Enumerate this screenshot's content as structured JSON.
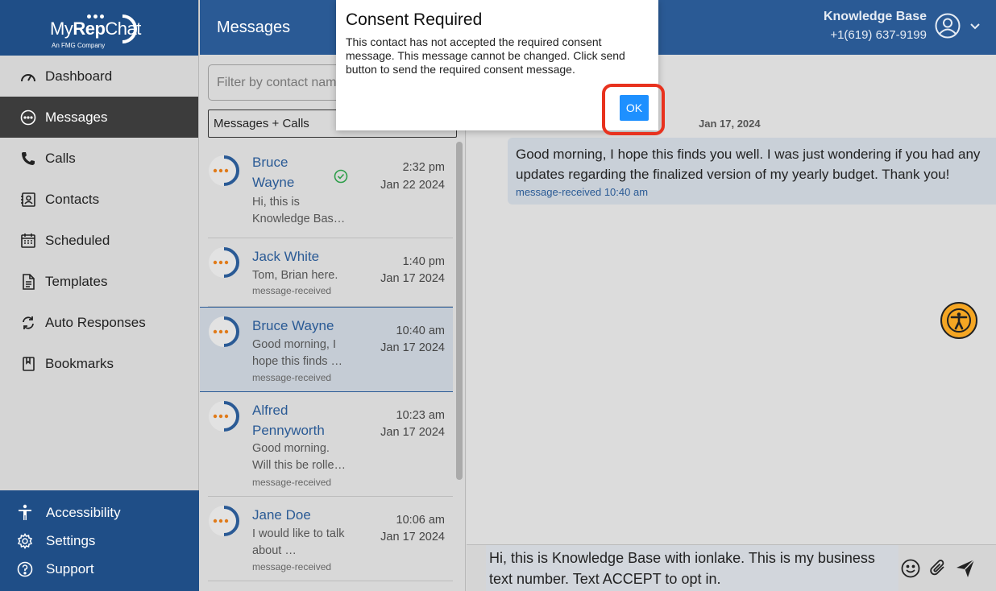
{
  "brand": {
    "logo_my": "My",
    "logo_rep": "Rep",
    "logo_chat": "Chat",
    "logo_sub": "An FMG Company"
  },
  "sidebar": {
    "items": [
      {
        "label": "Dashboard",
        "icon": "gauge-icon"
      },
      {
        "label": "Messages",
        "icon": "chat-bubble-icon",
        "active": true
      },
      {
        "label": "Calls",
        "icon": "phone-icon"
      },
      {
        "label": "Contacts",
        "icon": "contact-card-icon"
      },
      {
        "label": "Scheduled",
        "icon": "calendar-icon"
      },
      {
        "label": "Templates",
        "icon": "document-icon"
      },
      {
        "label": "Auto Responses",
        "icon": "refresh-icon"
      },
      {
        "label": "Bookmarks",
        "icon": "bookmark-icon"
      }
    ],
    "bottom": [
      {
        "label": "Accessibility",
        "icon": "accessibility-icon"
      },
      {
        "label": "Settings",
        "icon": "gear-icon"
      },
      {
        "label": "Support",
        "icon": "help-icon"
      }
    ]
  },
  "header": {
    "title": "Messages",
    "account_name": "Knowledge Base",
    "account_phone": "+1(619) 637-9199"
  },
  "list": {
    "filter_placeholder": "Filter by contact name",
    "type_select": "Messages + Calls",
    "conversations": [
      {
        "name": "Bruce Wayne",
        "preview": "Hi, this is Knowledge Bas…",
        "status": "",
        "time": "2:32 pm",
        "date": "Jan 22 2024",
        "check": true
      },
      {
        "name": "Jack White",
        "preview": "Tom, Brian here.",
        "status": "message-received",
        "time": "1:40 pm",
        "date": "Jan 17 2024"
      },
      {
        "name": "Bruce Wayne",
        "preview": "Good morning, I hope this finds …",
        "status": "message-received",
        "time": "10:40 am",
        "date": "Jan 17 2024",
        "selected": true
      },
      {
        "name": "Alfred Pennyworth",
        "preview": "Good morning. Will this be rolle…",
        "status": "message-received",
        "time": "10:23 am",
        "date": "Jan 17 2024"
      },
      {
        "name": "Jane Doe",
        "preview": "I would like to talk about …",
        "status": "message-received",
        "time": "10:06 am",
        "date": "Jan 17 2024"
      }
    ]
  },
  "chat": {
    "date_separator": "Jan 17, 2024",
    "message_text": "Good morning, I hope this finds you well. I was just wondering if you had any updates regarding the finalized version of my yearly budget. Thank you!",
    "message_meta": "message-received 10:40 am",
    "composer_text": "Hi, this is Knowledge Base with ionlake. This is my business text number. Text ACCEPT to opt in."
  },
  "modal": {
    "title": "Consent Required",
    "body": "This contact has not accepted the required consent message. This message cannot be changed. Click send button to send the required consent message.",
    "ok_label": "OK"
  },
  "colors": {
    "brand_blue": "#1f4e87",
    "header_blue": "#2a5a95",
    "highlight_red": "#e8321e",
    "ok_blue": "#1e90ff",
    "a11y_orange": "#f5a623"
  }
}
